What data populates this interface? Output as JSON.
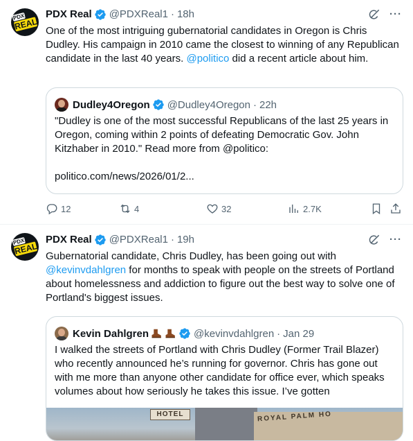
{
  "tweets": [
    {
      "author_name": "PDX Real",
      "author_handle": "@PDXReal1",
      "time": "18h",
      "avatar_top": "PDX",
      "avatar_bottom": "REAL",
      "text_before": "One of the most intriguing gubernatorial candidates in Oregon is Chris Dudley. His campaign in 2010 came the closest to winning of any Republican candidate in the last 40 years. ",
      "text_link": "@politico",
      "text_after": " did a recent article about him.",
      "quote": {
        "author_name": "Dudley4Oregon",
        "author_handle": "@Dudley4Oregon",
        "time": "22h",
        "text": "\"Dudley is one of the most successful Republicans of the last 25 years in Oregon, coming within 2 points of defeating Democratic Gov. John Kitzhaber in 2010.\" Read more from @politico:",
        "link": "politico.com/news/2026/01/2..."
      },
      "metrics": {
        "replies": "12",
        "reposts": "4",
        "likes": "32",
        "views": "2.7K"
      }
    },
    {
      "author_name": "PDX Real",
      "author_handle": "@PDXReal1",
      "time": "19h",
      "avatar_top": "PDX",
      "avatar_bottom": "REAL",
      "text_before": "Gubernatorial candidate, Chris Dudley, has been going out with ",
      "text_link": "@kevinvdahlgren",
      "text_after": " for months to speak with people on the streets of Portland about homelessness and addiction to figure out the best way to solve one of Portland's biggest issues.",
      "quote": {
        "author_name": "Kevin Dahlgren",
        "author_handle": "@kevinvdahlgren",
        "time": "Jan 29",
        "text": "I walked the streets of Portland with Chris Dudley (Former Trail Blazer) who recently announced he’s running for governor. Chris has gone out with me more than anyone other candidate for office ever, which speaks volumes about how seriously he takes this issue. I’ve gotten",
        "photo_sign_1": "HOTEL",
        "photo_sign_2": "ROYAL PALM HO"
      }
    }
  ],
  "icons": {
    "verified": "verified-badge-icon",
    "grok": "grok-icon",
    "more": "more-icon",
    "reply": "reply-icon",
    "repost": "repost-icon",
    "like": "like-icon",
    "views": "views-icon",
    "bookmark": "bookmark-icon",
    "share": "share-icon",
    "boot": "boot-emoji-icon"
  },
  "ui": {
    "separator": "·",
    "more_glyph": "···"
  },
  "colors": {
    "accent": "#1d9bf0",
    "text": "#0f1419",
    "secondary": "#536471",
    "border": "#cfd9de"
  }
}
